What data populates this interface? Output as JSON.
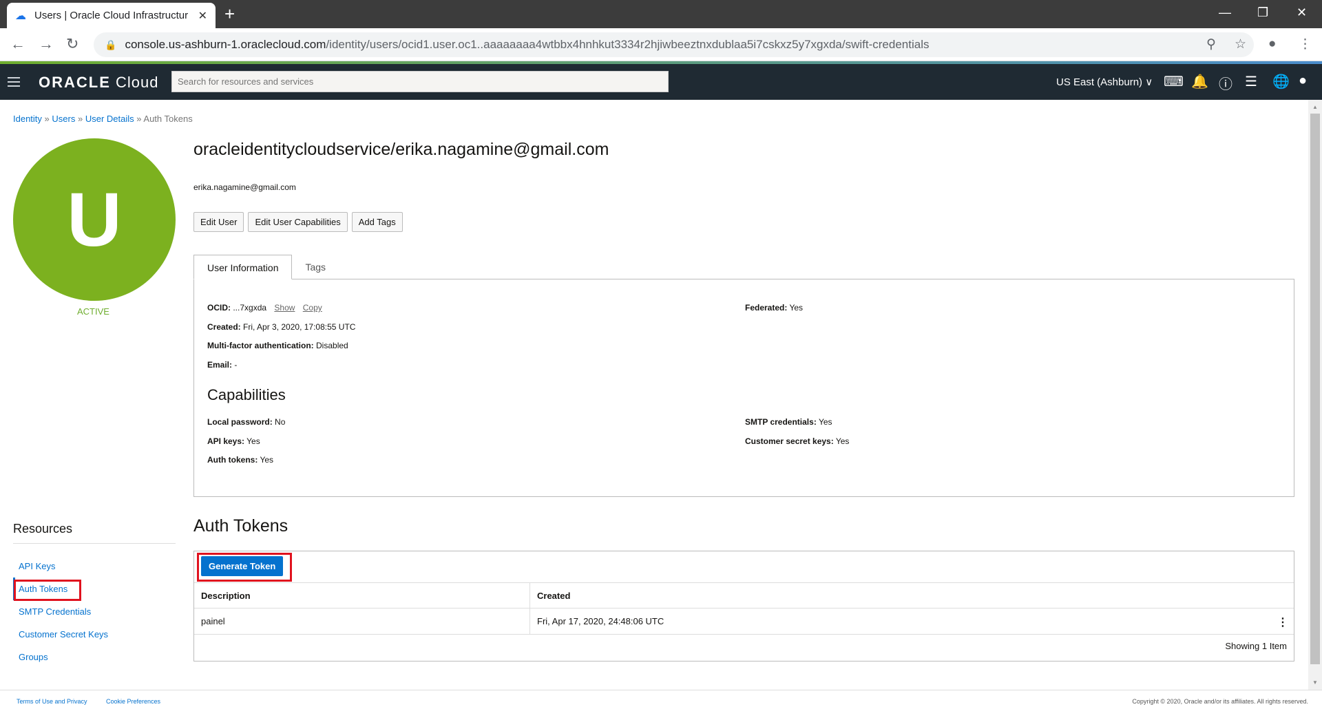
{
  "browser": {
    "tab_title": "Users | Oracle Cloud Infrastructur",
    "new_tab": "+",
    "url_host": "console.us-ashburn-1.oraclecloud.com",
    "url_path": "/identity/users/ocid1.user.oc1..aaaaaaaa4wtbbx4hnhkut3334r2hjiwbeeztnxdublaa5i7cskxz5y7xgxda/swift-credentials"
  },
  "header": {
    "logo_brand": "ORACLE",
    "logo_product": "Cloud",
    "search_placeholder": "Search for resources and services",
    "region": "US East (Ashburn) ∨"
  },
  "breadcrumb": {
    "items": [
      "Identity",
      "Users",
      "User Details"
    ],
    "separator": "»",
    "current": "Auth Tokens"
  },
  "user": {
    "initial": "U",
    "status": "ACTIVE",
    "display_name": "oracleidentitycloudservice/erika.nagamine@gmail.com",
    "email": "erika.nagamine@gmail.com"
  },
  "actions": {
    "edit_user": "Edit User",
    "edit_capabilities": "Edit User Capabilities",
    "add_tags": "Add Tags"
  },
  "tabs": {
    "user_information": "User Information",
    "tags": "Tags"
  },
  "user_info": {
    "ocid_label": "OCID:",
    "ocid_value": "...7xgxda",
    "show_link": "Show",
    "copy_link": "Copy",
    "created_label": "Created:",
    "created_value": "Fri, Apr 3, 2020, 17:08:55 UTC",
    "mfa_label": "Multi-factor authentication:",
    "mfa_value": "Disabled",
    "email_label": "Email:",
    "email_value": "-",
    "federated_label": "Federated:",
    "federated_value": "Yes"
  },
  "capabilities": {
    "title": "Capabilities",
    "local_password_label": "Local password:",
    "local_password_value": "No",
    "api_keys_label": "API keys:",
    "api_keys_value": "Yes",
    "auth_tokens_label": "Auth tokens:",
    "auth_tokens_value": "Yes",
    "smtp_label": "SMTP credentials:",
    "smtp_value": "Yes",
    "customer_secret_label": "Customer secret keys:",
    "customer_secret_value": "Yes"
  },
  "resources": {
    "title": "Resources",
    "items": [
      "API Keys",
      "Auth Tokens",
      "SMTP Credentials",
      "Customer Secret Keys",
      "Groups"
    ]
  },
  "auth_tokens": {
    "title": "Auth Tokens",
    "generate_button": "Generate Token",
    "columns": [
      "Description",
      "Created"
    ],
    "rows": [
      {
        "description": "painel",
        "created": "Fri, Apr 17, 2020, 24:48:06 UTC"
      }
    ],
    "footer": "Showing 1 Item"
  },
  "footer": {
    "terms": "Terms of Use and Privacy",
    "cookies": "Cookie Preferences",
    "copyright": "Copyright © 2020, Oracle and/or its affiliates. All rights reserved."
  },
  "colors": {
    "avatar": "#7cb11f",
    "link": "#0572ce",
    "header_bg": "#1f2a33",
    "highlight": "#e0121e"
  }
}
